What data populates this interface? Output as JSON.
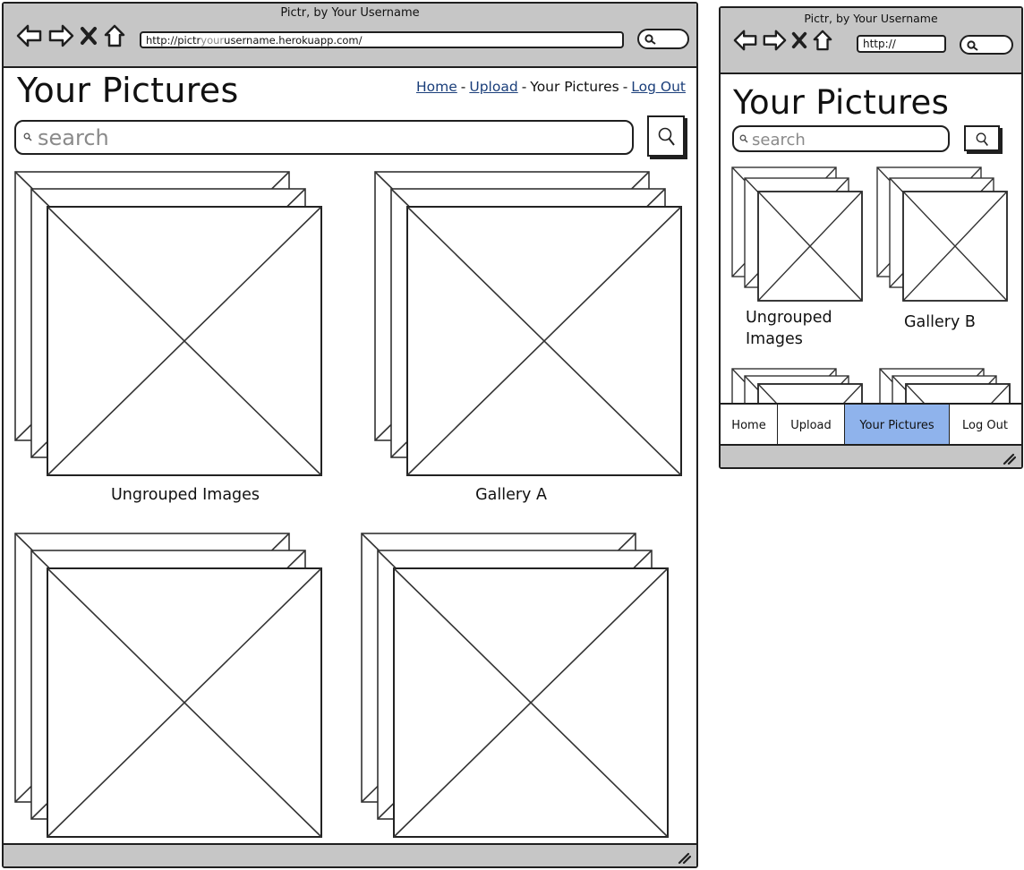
{
  "desktop": {
    "window_title": "Pictr, by Your Username",
    "url": {
      "prefix": "http://pictr",
      "highlight": "your",
      "suffix": "username.herokuapp.com/"
    },
    "page_title": "Your Pictures",
    "nav": {
      "home": "Home",
      "upload": "Upload",
      "current": "Your Pictures",
      "logout": "Log Out",
      "sep": "-"
    },
    "search": {
      "placeholder": "search"
    },
    "galleries": [
      {
        "caption": "Ungrouped Images"
      },
      {
        "caption": "Gallery A"
      },
      {
        "caption": ""
      },
      {
        "caption": ""
      }
    ]
  },
  "mobile": {
    "window_title": "Pictr, by Your Username",
    "url": "http://",
    "page_title": "Your Pictures",
    "search": {
      "placeholder": "search"
    },
    "galleries": [
      {
        "caption_line1": "Ungrouped",
        "caption_line2": "Images"
      },
      {
        "caption_line1": "Gallery B",
        "caption_line2": ""
      }
    ],
    "tabs": [
      {
        "label": "Home",
        "active": false
      },
      {
        "label": "Upload",
        "active": false
      },
      {
        "label": "Your Pictures",
        "active": true
      },
      {
        "label": "Log Out",
        "active": false
      }
    ]
  },
  "colors": {
    "chrome": "#c6c6c6",
    "active_tab": "#8fb3ec",
    "link": "#1a3e7a",
    "placeholder_text": "#8a8a8a"
  },
  "icons": [
    "back-arrow-icon",
    "forward-arrow-icon",
    "stop-icon",
    "home-icon",
    "search-icon",
    "resize-grip-icon",
    "image-placeholder-icon"
  ]
}
